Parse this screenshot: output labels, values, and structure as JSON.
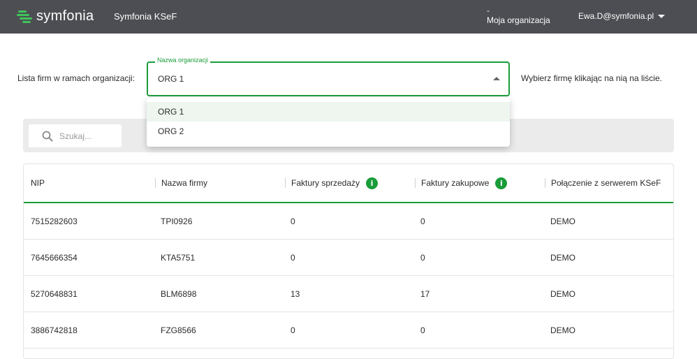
{
  "header": {
    "logo_text": "symfonia",
    "app_name": "Symfonia KSeF",
    "org_dash": "-",
    "org_label": "Moja organizacja",
    "user_email": "Ewa.D@symfonia.pl"
  },
  "org_selector": {
    "row_label": "Lista firm w ramach organizacji:",
    "field_label": "Nazwa organizacji",
    "selected_value": "ORG 1",
    "hint": "Wybierz firmę klikając na nią na liście.",
    "options": [
      "ORG 1",
      "ORG 2"
    ]
  },
  "search": {
    "placeholder": "Szukaj..."
  },
  "table": {
    "columns": [
      "NIP",
      "Nazwa firmy",
      "Faktury sprzedaży",
      "Faktury zakupowe",
      "Połączenie z serwerem KSeF"
    ],
    "rows": [
      [
        "7515282603",
        "TPI0926",
        "0",
        "0",
        "DEMO"
      ],
      [
        "7645666354",
        "KTA5751",
        "0",
        "0",
        "DEMO"
      ],
      [
        "5270648831",
        "BLM6898",
        "13",
        "17",
        "DEMO"
      ],
      [
        "3886742818",
        "FZG8566",
        "0",
        "0",
        "DEMO"
      ]
    ]
  },
  "colors": {
    "header_bg": "#4d4e53",
    "accent": "#1a9c3a",
    "logo_green": "#3fc35b"
  },
  "icons": {
    "info": "i"
  }
}
